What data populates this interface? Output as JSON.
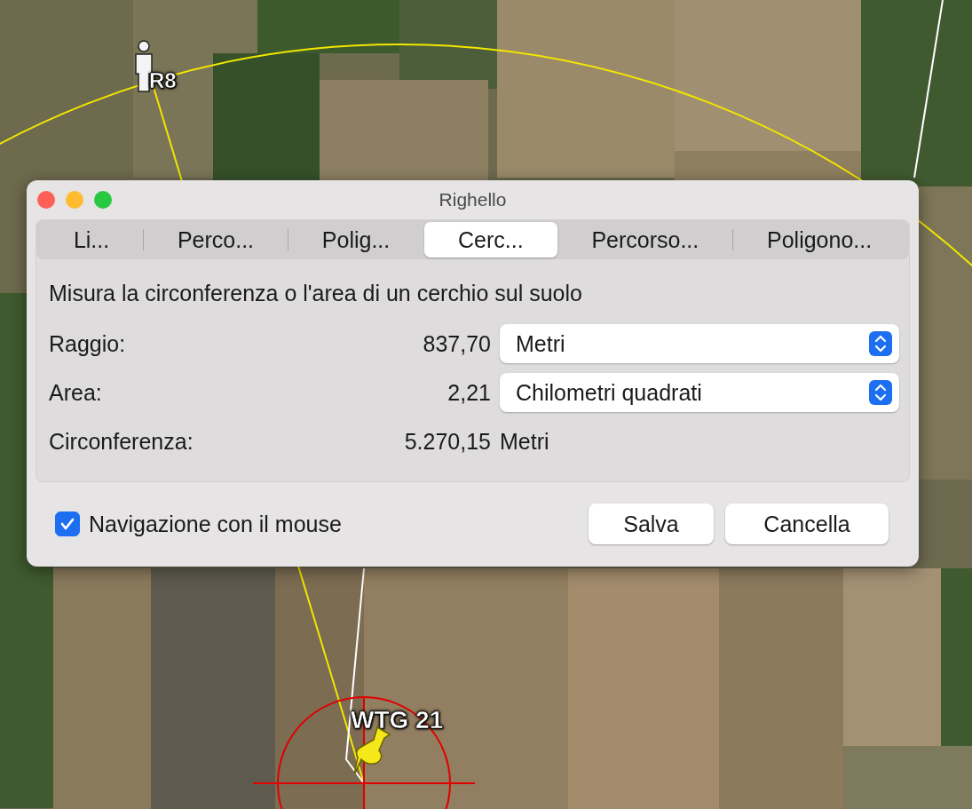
{
  "window": {
    "title": "Righello"
  },
  "tabs": [
    {
      "label": "Li...",
      "selected": false
    },
    {
      "label": "Perco...",
      "selected": false
    },
    {
      "label": "Polig...",
      "selected": false
    },
    {
      "label": "Cerc...",
      "selected": true
    },
    {
      "label": "Percorso...",
      "selected": false
    },
    {
      "label": "Poligono...",
      "selected": false
    }
  ],
  "description": "Misura la circonferenza o l'area di un cerchio sul suolo",
  "rows": [
    {
      "kind": "select",
      "label": "Raggio:",
      "value": "837,70",
      "unit": "Metri"
    },
    {
      "kind": "select",
      "label": "Area:",
      "value": "2,21",
      "unit": "Chilometri quadrati"
    },
    {
      "kind": "text",
      "label": "Circonferenza:",
      "value": "5.270,15",
      "unit": "Metri"
    }
  ],
  "mouse_navigation": {
    "label": "Navigazione con il mouse",
    "checked": true
  },
  "buttons": [
    "Salva",
    "Cancella"
  ],
  "map": {
    "placemarks": [
      {
        "kind": "person",
        "label": "R8"
      },
      {
        "kind": "pin",
        "label": "WTG 21"
      }
    ]
  }
}
